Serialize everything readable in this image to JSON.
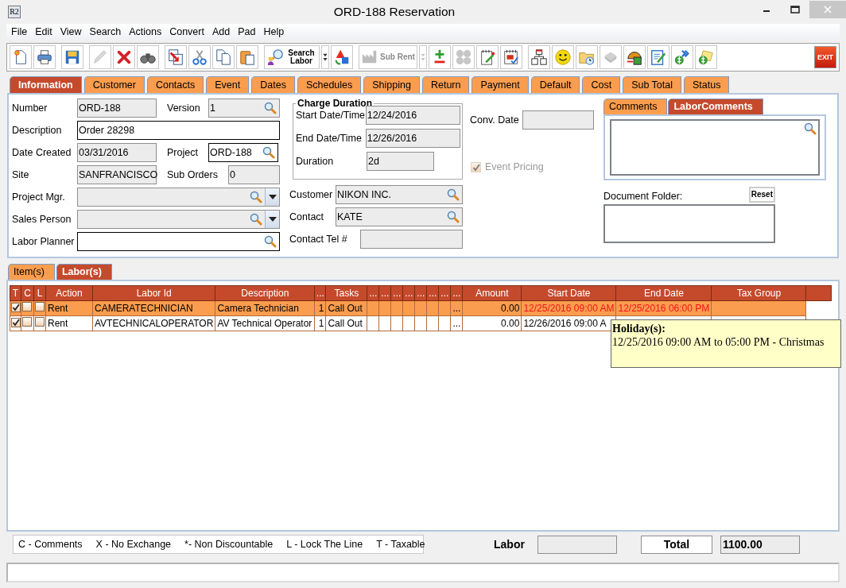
{
  "window": {
    "title": "ORD-188 Reservation",
    "icon_text": "R2"
  },
  "menu": [
    "File",
    "Edit",
    "View",
    "Search",
    "Actions",
    "Convert",
    "Add",
    "Pad",
    "Help"
  ],
  "toolbar": {
    "groups": [
      [
        {
          "kind": "icon",
          "disabled": false
        },
        {
          "kind": "icon",
          "disabled": false
        }
      ],
      [
        {
          "kind": "icon",
          "disabled": false
        }
      ],
      [
        {
          "kind": "icon",
          "disabled": true
        },
        {
          "kind": "icon",
          "disabled": false
        },
        {
          "kind": "icon",
          "disabled": false
        }
      ],
      [
        {
          "kind": "icon",
          "disabled": false
        },
        {
          "kind": "icon",
          "disabled": false
        },
        {
          "kind": "icon",
          "disabled": false
        },
        {
          "kind": "icon",
          "disabled": false
        }
      ],
      [
        {
          "kind": "labeled",
          "label": "Search Labor",
          "disabled": false
        },
        {
          "kind": "dropdown",
          "disabled": false
        },
        {
          "kind": "icon",
          "disabled": false
        }
      ],
      [
        {
          "kind": "labeled",
          "label": "Sub Rent",
          "disabled": true
        },
        {
          "kind": "dropdown",
          "disabled": true
        },
        {
          "kind": "icon",
          "disabled": false
        },
        {
          "kind": "icon",
          "disabled": true
        },
        {
          "kind": "icon",
          "disabled": false
        },
        {
          "kind": "icon",
          "disabled": false
        }
      ],
      [
        {
          "kind": "icon",
          "disabled": false
        },
        {
          "kind": "icon",
          "disabled": false
        },
        {
          "kind": "icon",
          "disabled": false
        },
        {
          "kind": "icon",
          "disabled": true
        },
        {
          "kind": "icon",
          "disabled": false
        },
        {
          "kind": "icon",
          "disabled": false
        },
        {
          "kind": "icon",
          "disabled": false
        },
        {
          "kind": "icon",
          "disabled": false
        }
      ]
    ],
    "exit": "EXIT"
  },
  "tabs": [
    {
      "label": "Information",
      "selected": true
    },
    {
      "label": "Customer",
      "selected": false
    },
    {
      "label": "Contacts",
      "selected": false
    },
    {
      "label": "Event",
      "selected": false
    },
    {
      "label": "Dates",
      "selected": false
    },
    {
      "label": "Schedules",
      "selected": false
    },
    {
      "label": "Shipping",
      "selected": false
    },
    {
      "label": "Return",
      "selected": false
    },
    {
      "label": "Payment",
      "selected": false
    },
    {
      "label": "Default",
      "selected": false
    },
    {
      "label": "Cost",
      "selected": false
    },
    {
      "label": "Sub Total",
      "selected": false
    },
    {
      "label": "Status",
      "selected": false
    }
  ],
  "info": {
    "number": {
      "label": "Number",
      "value": "ORD-188",
      "readonly": true
    },
    "version": {
      "label": "Version",
      "value": "1",
      "readonly": true,
      "lookup": true
    },
    "description": {
      "label": "Description",
      "value": "Order 28298",
      "readonly": false
    },
    "date_created": {
      "label": "Date Created",
      "value": "03/31/2016",
      "readonly": true
    },
    "project": {
      "label": "Project",
      "value": "ORD-188",
      "readonly": false,
      "lookup": true
    },
    "site": {
      "label": "Site",
      "value": "SANFRANCISCO",
      "readonly": true
    },
    "sub_orders": {
      "label": "Sub Orders",
      "value": "0",
      "readonly": true
    },
    "project_mgr": {
      "label": "Project Mgr.",
      "readonly": true,
      "lookup": true,
      "dropdown": true
    },
    "sales_person": {
      "label": "Sales Person",
      "readonly": true,
      "lookup": true,
      "dropdown": true
    },
    "labor_planner": {
      "label": "Labor Planner",
      "readonly": false,
      "lookup": true
    },
    "charge_duration": {
      "title": "Charge Duration",
      "fields": [
        {
          "label": "Start Date/Time",
          "value": "12/24/2016",
          "readonly": true
        },
        {
          "label": "End Date/Time",
          "value": "12/26/2016",
          "readonly": true
        },
        {
          "label": "Duration",
          "value": "2d",
          "readonly": true
        }
      ]
    },
    "customer": {
      "label": "Customer",
      "value": "NIKON INC.",
      "readonly": true,
      "lookup": true
    },
    "contact": {
      "label": "Contact",
      "value": "KATE",
      "readonly": true,
      "lookup": true
    },
    "contact_tel": {
      "label": "Contact Tel #",
      "readonly": true
    },
    "conv_date": {
      "label": "Conv. Date",
      "readonly": true
    },
    "event_pricing": {
      "label": "Event Pricing",
      "checked": true,
      "disabled": true
    },
    "comment_tabs": [
      {
        "label": "Comments",
        "selected": false
      },
      {
        "label": "LaborComments",
        "selected": true
      }
    ],
    "document_folder": {
      "label": "Document Folder:",
      "reset": "Reset"
    }
  },
  "line_tabs": [
    {
      "label": "Item(s)",
      "selected": false
    },
    {
      "label": "Labor(s)",
      "selected": true
    }
  ],
  "labor": {
    "check_columns": [
      "T",
      "C",
      "L"
    ],
    "columns": [
      {
        "label": "Action",
        "kind": "text"
      },
      {
        "label": "Labor Id",
        "kind": "text"
      },
      {
        "label": "Description",
        "kind": "text"
      },
      {
        "label": "...",
        "kind": "number"
      },
      {
        "label": "Tasks",
        "kind": "text"
      },
      {
        "label": "...",
        "kind": "text"
      },
      {
        "label": "...",
        "kind": "text"
      },
      {
        "label": "...",
        "kind": "text"
      },
      {
        "label": "...",
        "kind": "text"
      },
      {
        "label": "...",
        "kind": "text"
      },
      {
        "label": "...",
        "kind": "text"
      },
      {
        "label": "...",
        "kind": "text"
      },
      {
        "label": "...",
        "kind": "number"
      },
      {
        "label": "Amount",
        "kind": "number"
      },
      {
        "label": "Start Date",
        "kind": "date"
      },
      {
        "label": "End Date",
        "kind": "date"
      },
      {
        "label": "Tax Group",
        "kind": "text"
      }
    ],
    "rows": [
      {
        "selected": true,
        "holiday": true,
        "checks": [
          true,
          false,
          false
        ],
        "cells": [
          "Rent",
          "CAMERATECHNICIAN",
          "Camera Technician",
          "1",
          "Call Out",
          null,
          null,
          null,
          null,
          null,
          null,
          null,
          "...",
          "0.00",
          "12/25/2016 09:00 AM",
          "12/25/2016 06:00 PM",
          null
        ]
      },
      {
        "selected": false,
        "holiday": false,
        "checks": [
          true,
          false,
          false
        ],
        "cells": [
          "Rent",
          "AVTECHNICALOPERATOR",
          "AV Technical Operator",
          "1",
          "Call Out",
          null,
          null,
          null,
          null,
          null,
          null,
          null,
          "...",
          "0.00",
          "12/26/2016 09:00 A",
          null,
          null
        ]
      }
    ],
    "tooltip": {
      "title": "Holiday(s):",
      "text": "12/25/2016 09:00 AM to 05:00 PM - Christmas"
    }
  },
  "legend": [
    "C - Comments",
    "X - No Exchange",
    "*- Non Discountable",
    "L - Lock The Line",
    "T - Taxable"
  ],
  "totals": {
    "labor_label": "Labor",
    "total_label": "Total",
    "total_value": "1100.00"
  }
}
